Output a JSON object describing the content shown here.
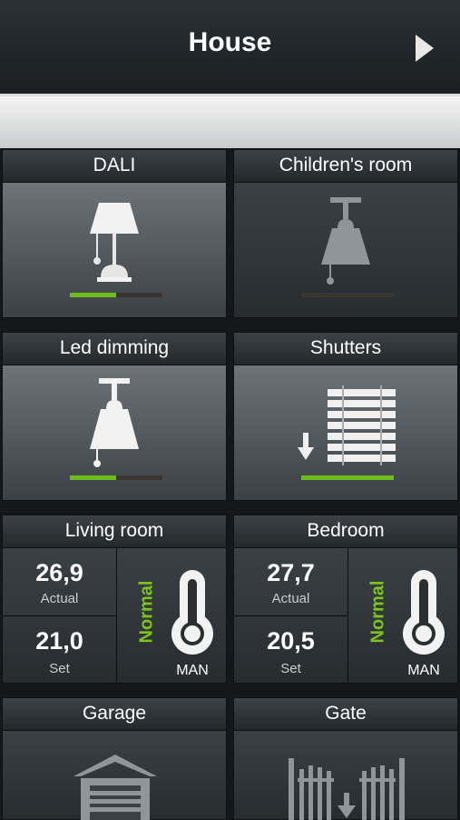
{
  "header": {
    "title": "House"
  },
  "tiles": [
    {
      "title": "DALI",
      "level": 0.5
    },
    {
      "title": "Children's room",
      "level": 0
    },
    {
      "title": "Led dimming",
      "level": 0.5
    },
    {
      "title": "Shutters",
      "level": 1.0
    }
  ],
  "climate": [
    {
      "title": "Living room",
      "actual": "26,9",
      "actual_label": "Actual",
      "set": "21,0",
      "set_label": "Set",
      "mode": "Normal",
      "control": "MAN"
    },
    {
      "title": "Bedroom",
      "actual": "27,7",
      "actual_label": "Actual",
      "set": "20,5",
      "set_label": "Set",
      "mode": "Normal",
      "control": "MAN"
    }
  ],
  "bottom_tiles": [
    {
      "title": "Garage"
    },
    {
      "title": "Gate"
    }
  ],
  "colors": {
    "accent": "#6cbc1c"
  }
}
